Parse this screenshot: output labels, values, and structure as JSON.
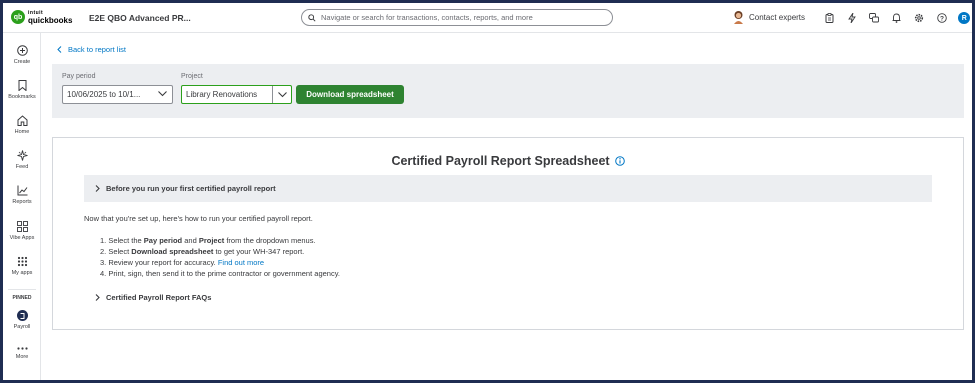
{
  "topbar": {
    "logo_brand": "intuit",
    "logo_product": "quickbooks",
    "logo_mark": "qb",
    "company_name": "E2E QBO Advanced PR...",
    "search_placeholder": "Navigate or search for transactions, contacts, reports, and more",
    "contact_label": "Contact experts",
    "user_initial": "R",
    "icons": [
      "clipboard-icon",
      "lightning-icon",
      "chat-icon",
      "bell-icon",
      "gear-icon",
      "help-icon"
    ]
  },
  "nav": {
    "items": [
      {
        "label": "Create",
        "icon": "plus-circle-icon"
      },
      {
        "label": "Bookmarks",
        "icon": "bookmark-icon"
      },
      {
        "label": "Home",
        "icon": "home-icon"
      },
      {
        "label": "Feed",
        "icon": "sparkle-icon"
      },
      {
        "label": "Reports",
        "icon": "chart-icon"
      },
      {
        "label": "Vibe Apps",
        "icon": "apps-grid-icon"
      },
      {
        "label": "My apps",
        "icon": "dots-grid-icon"
      }
    ],
    "pinned_label": "PINNED",
    "payroll_label": "Payroll",
    "more_label": "More"
  },
  "main": {
    "back_link": "Back to report list",
    "filters": {
      "pay_period_label": "Pay period",
      "pay_period_value": "10/06/2025 to 10/1...",
      "project_label": "Project",
      "project_value": "Library Renovations",
      "download_button": "Download spreadsheet"
    },
    "card": {
      "title": "Certified Payroll Report Spreadsheet",
      "accordion_label": "Before you run your first certified payroll report",
      "intro": "Now that you're set up, here's how to run your certified payroll report.",
      "steps": {
        "s1_pre": "1. Select the ",
        "s1_b1": "Pay period",
        "s1_mid": " and ",
        "s1_b2": "Project",
        "s1_post": " from the dropdown menus.",
        "s2_pre": "2. Select ",
        "s2_b": "Download spreadsheet",
        "s2_post": " to get your WH-347 report.",
        "s3_pre": "3. Review your report for accuracy. ",
        "s3_link": "Find out more",
        "s4": "4. Print, sign, then send it to the prime contractor or government agency."
      },
      "faq_label": "Certified Payroll Report FAQs"
    }
  },
  "colors": {
    "brand_green": "#2ca01c",
    "button_green": "#2e8331",
    "link_blue": "#0077c5",
    "frame_navy": "#1f2d52"
  }
}
